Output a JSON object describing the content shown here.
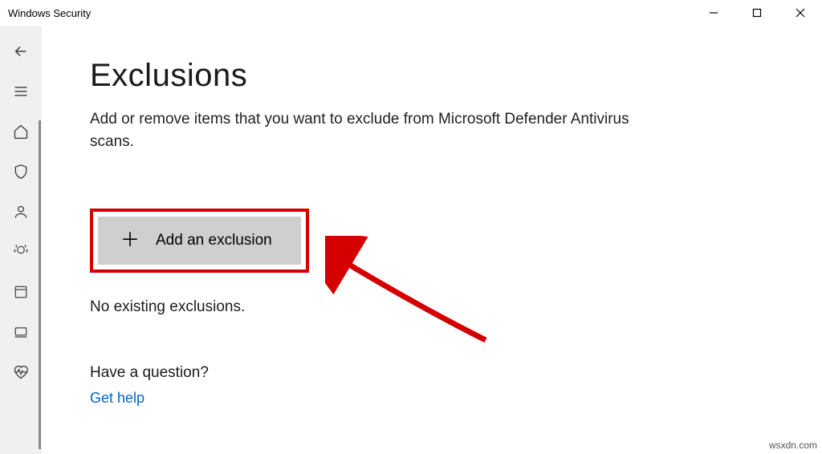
{
  "window": {
    "title": "Windows Security"
  },
  "page": {
    "heading": "Exclusions",
    "description": "Add or remove items that you want to exclude from Microsoft Defender Antivirus scans.",
    "add_button_label": "Add an exclusion",
    "status_text": "No existing exclusions.",
    "question_heading": "Have a question?",
    "help_link": "Get help"
  },
  "watermark": "wsxdn.com"
}
